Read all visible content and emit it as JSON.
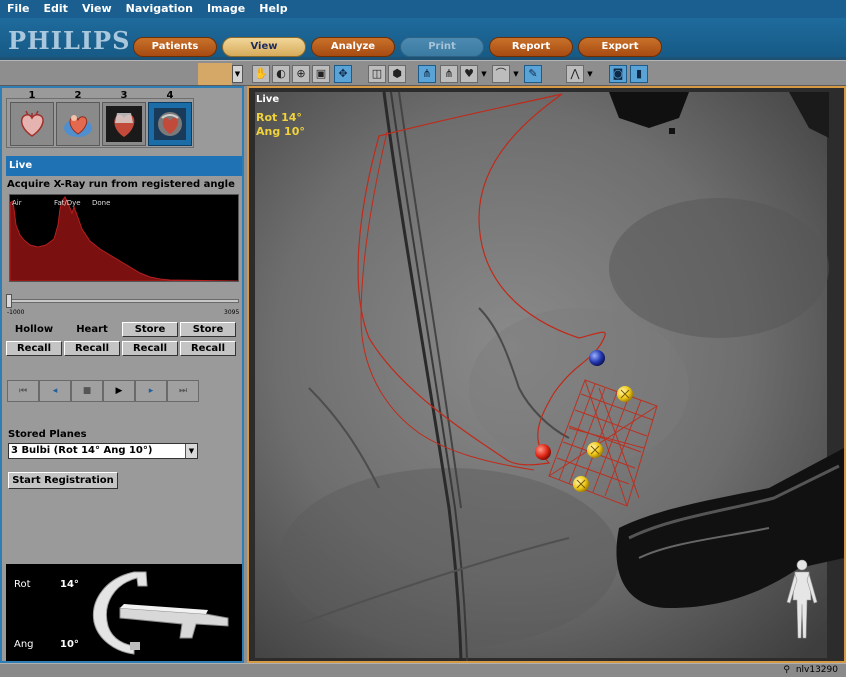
{
  "menu": [
    "File",
    "Edit",
    "View",
    "Navigation",
    "Image",
    "Help"
  ],
  "brand": "PHILIPS",
  "tabs": [
    {
      "label": "Patients",
      "state": "normal"
    },
    {
      "label": "View",
      "state": "active"
    },
    {
      "label": "Analyze",
      "state": "normal"
    },
    {
      "label": "Print",
      "state": "disabled"
    },
    {
      "label": "Report",
      "state": "normal"
    },
    {
      "label": "Export",
      "state": "normal"
    }
  ],
  "thumbnails": [
    "1",
    "2",
    "3",
    "4"
  ],
  "panel": {
    "title": "Live",
    "subtitle": "Acquire X-Ray run from registered angle",
    "histogram_labels": [
      "Air",
      "Fat/Dye",
      "Done"
    ],
    "slider_min": "-1000",
    "slider_max": "3095",
    "hollow_label": "Hollow",
    "heart_label": "Heart",
    "store_label": "Store",
    "recall_label": "Recall",
    "player_controls": [
      "first-frame",
      "prev-frame",
      "stop",
      "play",
      "next-frame",
      "last-frame"
    ],
    "stored_planes_label": "Stored Planes",
    "stored_planes_value": "3 Bulbi (Rot  14° Ang  10°)",
    "start_registration_label": "Start Registration",
    "rot_label": "Rot",
    "rot_value": "14°",
    "ang_label": "Ang",
    "ang_value": "10°"
  },
  "viewer": {
    "mode": "Live",
    "rot_text": "Rot  14°",
    "ang_text": "Ang  10°"
  },
  "status": {
    "user": "nlv13290"
  },
  "colors": {
    "accent_blue": "#1f72b4",
    "tab_orange": "#b85a1c",
    "overlay_yellow": "#f0d23a",
    "overlay_red": "#d8322a"
  }
}
